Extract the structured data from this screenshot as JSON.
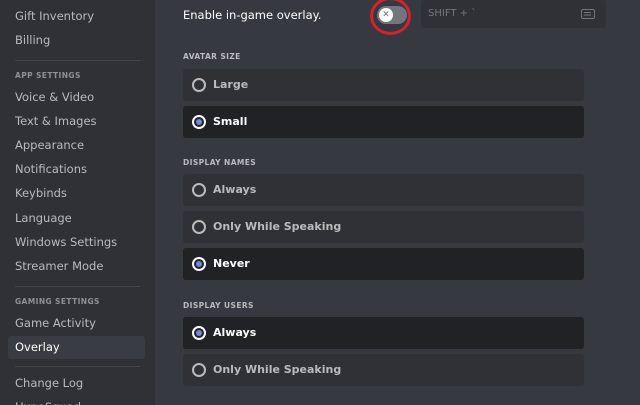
{
  "sidebar": {
    "items_top": [
      {
        "label": "Gift Inventory"
      },
      {
        "label": "Billing"
      }
    ],
    "app_settings_header": "APP SETTINGS",
    "app_settings": [
      {
        "label": "Voice & Video"
      },
      {
        "label": "Text & Images"
      },
      {
        "label": "Appearance"
      },
      {
        "label": "Notifications"
      },
      {
        "label": "Keybinds"
      },
      {
        "label": "Language"
      },
      {
        "label": "Windows Settings"
      },
      {
        "label": "Streamer Mode"
      }
    ],
    "gaming_settings_header": "GAMING SETTINGS",
    "gaming_settings": [
      {
        "label": "Game Activity"
      },
      {
        "label": "Overlay",
        "selected": true
      }
    ],
    "items_bottom": [
      {
        "label": "Change Log"
      },
      {
        "label": "HypeSquad"
      }
    ]
  },
  "overlay": {
    "enable_label": "Enable in-game overlay.",
    "toggle_on": false,
    "toggle_glyph": "✕",
    "keybind_text": "SHIFT + `",
    "keybind_icon": "keyboard-icon"
  },
  "avatar_size": {
    "title": "AVATAR SIZE",
    "options": [
      {
        "label": "Large",
        "selected": false
      },
      {
        "label": "Small",
        "selected": true
      }
    ]
  },
  "display_names": {
    "title": "DISPLAY NAMES",
    "options": [
      {
        "label": "Always",
        "selected": false
      },
      {
        "label": "Only While Speaking",
        "selected": false
      },
      {
        "label": "Never",
        "selected": true
      }
    ]
  },
  "display_users": {
    "title": "DISPLAY USERS",
    "options": [
      {
        "label": "Always",
        "selected": true
      },
      {
        "label": "Only While Speaking",
        "selected": false
      }
    ]
  },
  "colors": {
    "accent": "#7289da",
    "annotation_circle": "#d8202b"
  }
}
